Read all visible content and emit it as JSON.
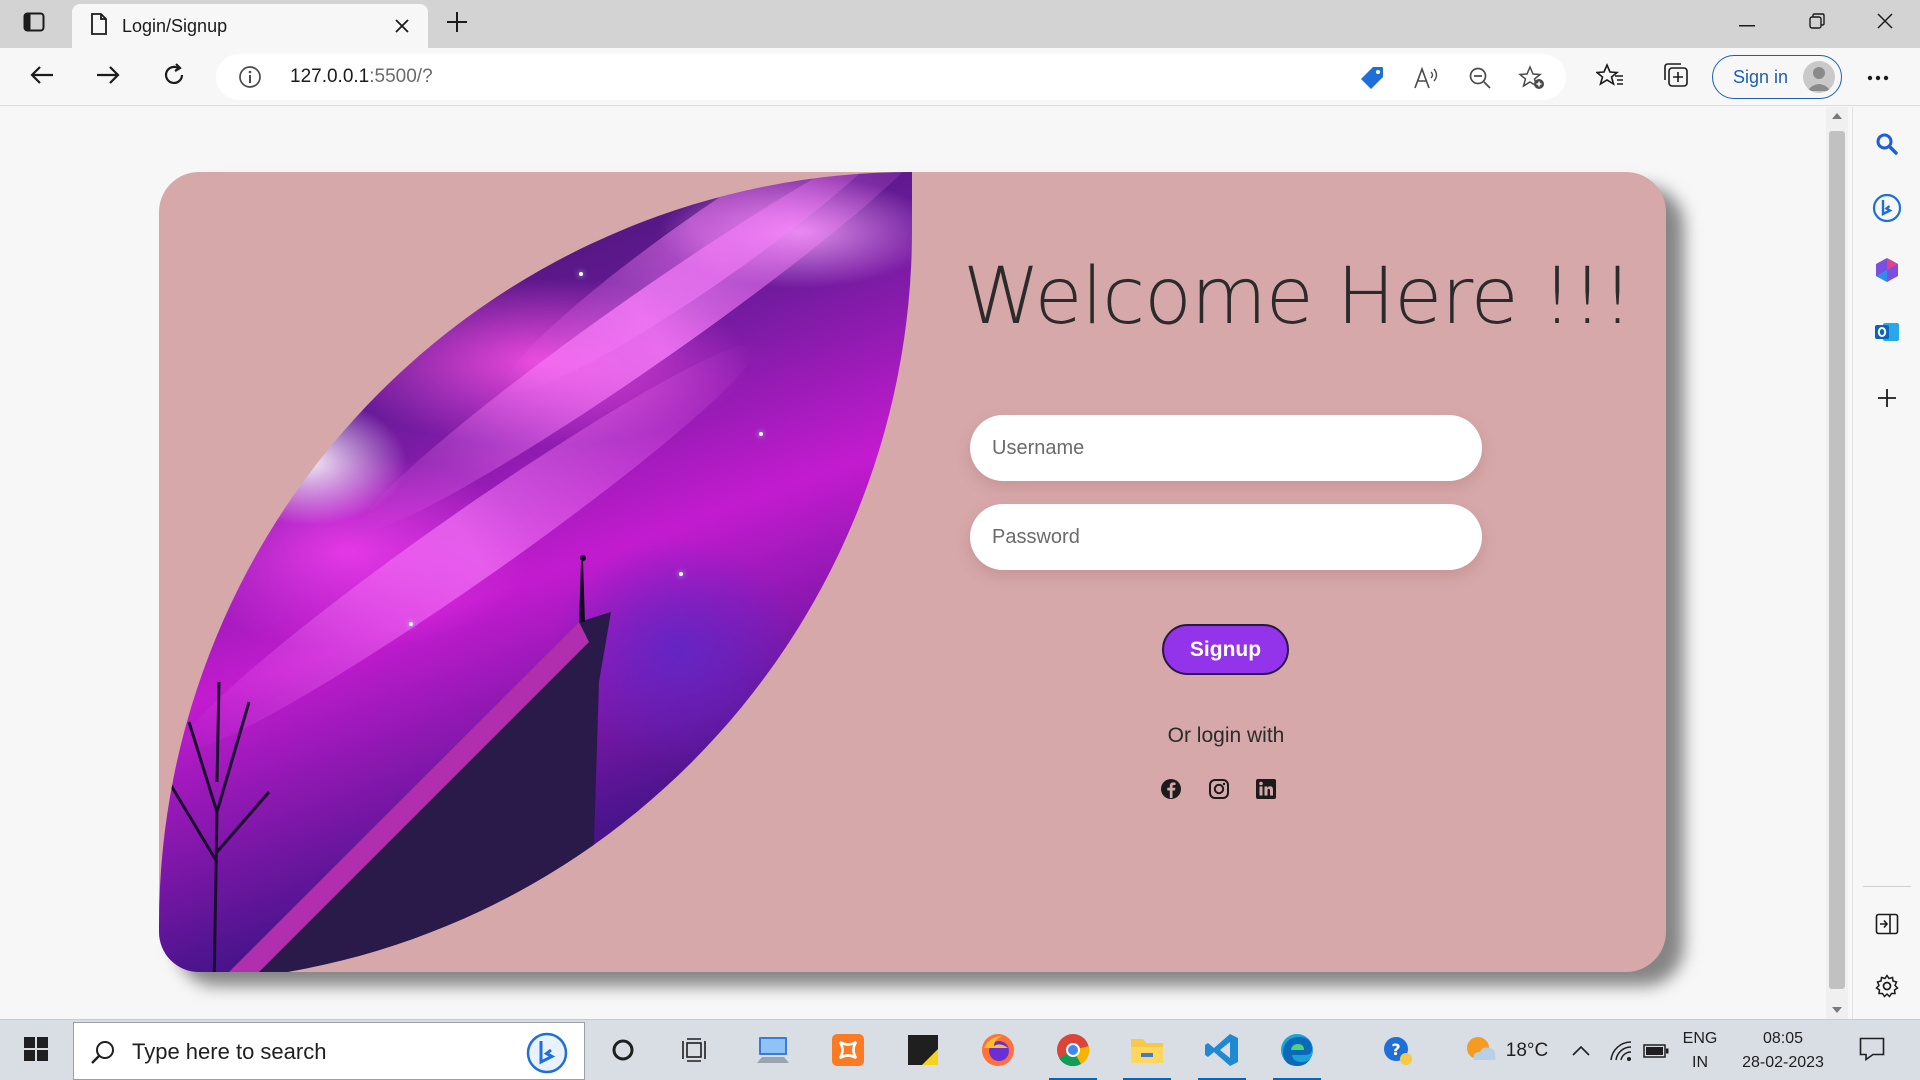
{
  "browser": {
    "tab": {
      "title": "Login/Signup"
    },
    "address": {
      "host": "127.0.0.1",
      "rest": ":5500/?"
    },
    "signin_label": "Sign in"
  },
  "page": {
    "heading": "Welcome Here !!!",
    "username_placeholder": "Username",
    "password_placeholder": "Password",
    "signup_label": "Signup",
    "or_login_label": "Or login with",
    "social_icons": [
      "facebook-icon",
      "instagram-icon",
      "linkedin-icon"
    ],
    "card_color": "#d6a8a9",
    "accent_color": "#9333ea"
  },
  "taskbar": {
    "search_placeholder": "Type here to search",
    "weather": "18°C",
    "lang_line1": "ENG",
    "lang_line2": "IN",
    "time": "08:05",
    "date": "28-02-2023"
  }
}
